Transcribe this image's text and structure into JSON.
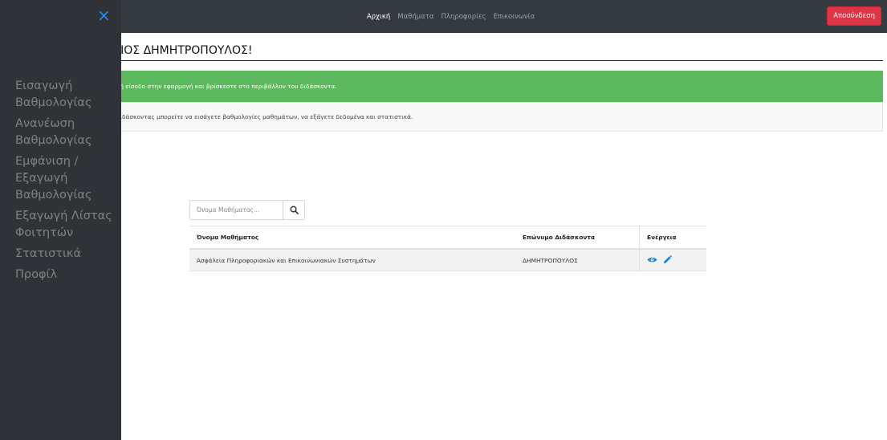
{
  "navbar": {
    "links": [
      "Αρχική",
      "Μαθήματα",
      "Πληροφορίες",
      "Επικοινωνία"
    ],
    "logout_label": "Αποσύνδεση",
    "colors": {
      "background": "#343a40",
      "logout": "#dc3545"
    }
  },
  "sidebar": {
    "close_glyph": "×",
    "items": [
      "Εισαγωγή Βαθμολογίας",
      "Ανανέωση Βαθμολογίας",
      "Εμφάνιση / Εξαγωγή Βαθμολογίας",
      "Εξαγωγή Λίστας Φοιτητών",
      "Στατιστικά",
      "Προφίλ"
    ],
    "colors": {
      "background": "#2f3337",
      "text": "#818181",
      "close": "#1e90ff"
    }
  },
  "main": {
    "greeting": "ΗΜΗΤΡΙΟΣ ΔΗΜΗΤΡΟΠΟΥΛΟΣ!",
    "alert_success": "χή είσοδο στην εφαρμογή και βρίσκεστε στο περιβάλλον του διδάσκοντα.",
    "info_text": "διδάσκοντας μπορείτε να εισάγετε βαθμολογίες μαθημάτων, να εξάγετε δεδομένα και στατιστικά.",
    "search": {
      "placeholder": "Όνομα Μαθήματος...",
      "icon": "search-icon"
    },
    "table": {
      "headers": [
        "Όνομα Μαθήματος",
        "Επώνυμο Διδάσκοντα",
        "Ενέργεια"
      ],
      "rows": [
        {
          "course": "Ασφάλεια Πληροφοριακών και Επικοινωνιακών Συστημάτων",
          "teacher": "ΔΗΜΗΤΡΟΠΟΥΛΟΣ",
          "actions": [
            "eye-icon",
            "pencil-icon"
          ]
        }
      ]
    },
    "colors": {
      "success": "#5cb85c",
      "action_icon": "#1e88e5"
    }
  }
}
